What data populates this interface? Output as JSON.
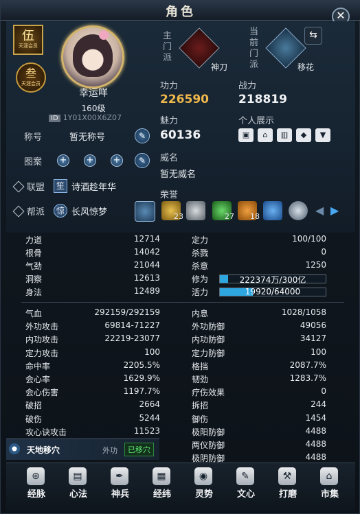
{
  "window": {
    "title": "角色"
  },
  "profile": {
    "badge_rank": "伍",
    "badge_rank_sub": "天涯会员",
    "badge_title": "叁",
    "badge_title_sub": "天涯会员",
    "name": "幸运咩",
    "level": "160级",
    "id_label": "ID",
    "id_value": "1Y01X00X6Z07"
  },
  "info": {
    "title_label": "称号",
    "title_value": "暂无称号",
    "pattern_label": "图案",
    "alliance_label": "联盟",
    "alliance_tag": "笙",
    "alliance_value": "诗酒趁年华",
    "guild_label": "帮派",
    "guild_tag": "惊",
    "guild_value": "长风惊梦"
  },
  "sect": {
    "main_label": "主门派",
    "main_name": "神刀",
    "current_label": "当前门派",
    "current_name": "移花",
    "swap_icon": "swap-icon"
  },
  "power": {
    "gongli_label": "功力",
    "gongli_value": "226590",
    "zhanli_label": "战力",
    "zhanli_value": "218819",
    "meili_label": "魅力",
    "meili_value": "60136",
    "show_label": "个人展示",
    "weiming_label": "威名",
    "weiming_value": "暂无威名",
    "honor_label": "荣誉",
    "honors": [
      {
        "count": "23"
      },
      {
        "count": ""
      },
      {
        "count": "27"
      },
      {
        "count": "18"
      },
      {
        "count": ""
      },
      {
        "count": ""
      }
    ]
  },
  "stats_top_left": [
    {
      "label": "力道",
      "value": "12714"
    },
    {
      "label": "根骨",
      "value": "14042"
    },
    {
      "label": "气劲",
      "value": "21044"
    },
    {
      "label": "洞察",
      "value": "12613"
    },
    {
      "label": "身法",
      "value": "12489"
    }
  ],
  "stats_top_right": [
    {
      "label": "定力",
      "value": "100/100"
    },
    {
      "label": "杀戮",
      "value": "0"
    },
    {
      "label": "杀意",
      "value": "1250"
    }
  ],
  "bars": {
    "xiuwei_label": "修为",
    "xiuwei_text": "222374万/300亿",
    "xiuwei_fill": 0.007,
    "huoli_label": "活力",
    "huoli_text": "19920/64000",
    "huoli_fill": 0.311
  },
  "stats_bottom_left": [
    {
      "label": "气血",
      "value": "292159/292159"
    },
    {
      "label": "外功攻击",
      "value": "69814-71227"
    },
    {
      "label": "内功攻击",
      "value": "22219-23077"
    },
    {
      "label": "定力攻击",
      "value": "100"
    },
    {
      "label": "命中率",
      "value": "2205.5%"
    },
    {
      "label": "会心率",
      "value": "1629.9%"
    },
    {
      "label": "会心伤害",
      "value": "1197.7%"
    },
    {
      "label": "破招",
      "value": "2664"
    },
    {
      "label": "破伤",
      "value": "5244"
    },
    {
      "label": "攻心诀攻击",
      "value": "11523"
    }
  ],
  "stats_bottom_right": [
    {
      "label": "内息",
      "value": "1028/1058"
    },
    {
      "label": "外功防御",
      "value": "49056"
    },
    {
      "label": "内功防御",
      "value": "34127"
    },
    {
      "label": "定力防御",
      "value": "100"
    },
    {
      "label": "格挡",
      "value": "2087.7%"
    },
    {
      "label": "韧劲",
      "value": "1283.7%"
    },
    {
      "label": "疗伤效果",
      "value": "0"
    },
    {
      "label": "拆招",
      "value": "244"
    },
    {
      "label": "御伤",
      "value": "1454"
    },
    {
      "label": "极阳防御",
      "value": "4488"
    },
    {
      "label": "两仪防御",
      "value": "4488"
    },
    {
      "label": "极阴防御",
      "value": "4488"
    }
  ],
  "skill": {
    "name": "天地移穴",
    "type": "外功",
    "status": "已移穴"
  },
  "nav": [
    {
      "label": "经脉",
      "icon": "meridian-icon"
    },
    {
      "label": "心法",
      "icon": "book-icon"
    },
    {
      "label": "神兵",
      "icon": "quill-icon"
    },
    {
      "label": "经纬",
      "icon": "grid-icon"
    },
    {
      "label": "灵势",
      "icon": "spirit-icon"
    },
    {
      "label": "文心",
      "icon": "brush-icon"
    },
    {
      "label": "打磨",
      "icon": "hammer-icon"
    },
    {
      "label": "市集",
      "icon": "market-icon"
    }
  ]
}
